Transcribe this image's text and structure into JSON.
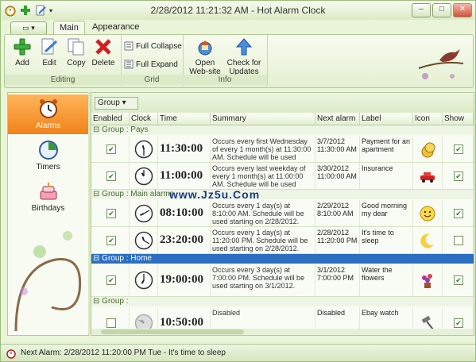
{
  "window": {
    "title": "2/28/2012 11:21:32 AM - Hot Alarm Clock"
  },
  "tabs": [
    {
      "label": "Main"
    },
    {
      "label": "Appearance"
    }
  ],
  "ribbon": {
    "editing": {
      "label": "Editing",
      "add": "Add",
      "edit": "Edit",
      "copy": "Copy",
      "delete": "Delete"
    },
    "grid": {
      "label": "Grid",
      "full_collapse": "Full Collapse",
      "full_expand": "Full Expand"
    },
    "info": {
      "label": "Info",
      "open_website": "Open Web-site",
      "check_updates": "Check for Updates"
    }
  },
  "nav": [
    {
      "label": "Alarms"
    },
    {
      "label": "Timers"
    },
    {
      "label": "Birthdays"
    }
  ],
  "grid": {
    "group_button": "Group",
    "columns": [
      "Enabled",
      "Clock",
      "Time",
      "Summary",
      "Next alarm",
      "Label",
      "Icon",
      "Show ..."
    ],
    "groups": [
      {
        "title": "Group : Pays",
        "rows": [
          {
            "enabled": true,
            "time": "11:30:00",
            "summary": "Occurs every first Wednesday of every 1 month(s) at 11:30:00 AM. Schedule will be used starting o...",
            "next_alarm": "3/7/2012 11:30:00 AM",
            "label": "Payment for an apartment",
            "icon": "coins-icon",
            "show": true
          },
          {
            "enabled": true,
            "time": "11:00:00",
            "summary": "Occurs every last weekday of every 1 month(s) at 11:00:00 AM. Schedule will be used starting o...",
            "next_alarm": "3/30/2012 11:00:00 AM",
            "label": "Insurance",
            "icon": "car-icon",
            "show": true
          }
        ]
      },
      {
        "title": "Group : Main alarms",
        "rows": [
          {
            "enabled": true,
            "time": "08:10:00",
            "summary": "Occurs every 1 day(s) at 8:10:00 AM. Schedule will be used starting on 2/28/2012.",
            "next_alarm": "2/29/2012 8:10:00 AM",
            "label": "Good morning my dear",
            "icon": "smiley-icon",
            "show": true
          },
          {
            "enabled": true,
            "time": "23:20:00",
            "summary": "Occurs every 1 day(s) at 11:20:00 PM. Schedule will be used starting on 2/28/2012.",
            "next_alarm": "2/28/2012 11:20:00 PM",
            "label": "It's time to sleep",
            "icon": "moon-icon",
            "show": false
          }
        ]
      },
      {
        "title": "Group : Home",
        "rows": [
          {
            "enabled": true,
            "time": "19:00:00",
            "summary": "Occurs every 3 day(s) at 7:00:00 PM. Schedule will be used starting on 3/1/2012.",
            "next_alarm": "3/1/2012 7:00:00 PM",
            "label": "Water the flowers",
            "icon": "flowers-icon",
            "show": true
          }
        ]
      },
      {
        "title": "Group :",
        "rows": [
          {
            "enabled": false,
            "time": "10:50:00",
            "summary": "Disabled",
            "next_alarm": "Disabled",
            "label": "Ebay watch",
            "icon": "gavel-icon",
            "show": true
          }
        ]
      }
    ]
  },
  "status": {
    "text": "Next Alarm: 2/28/2012 11:20:00 PM Tue - It's time to sleep"
  },
  "watermark": "www.Jz5u.Com"
}
